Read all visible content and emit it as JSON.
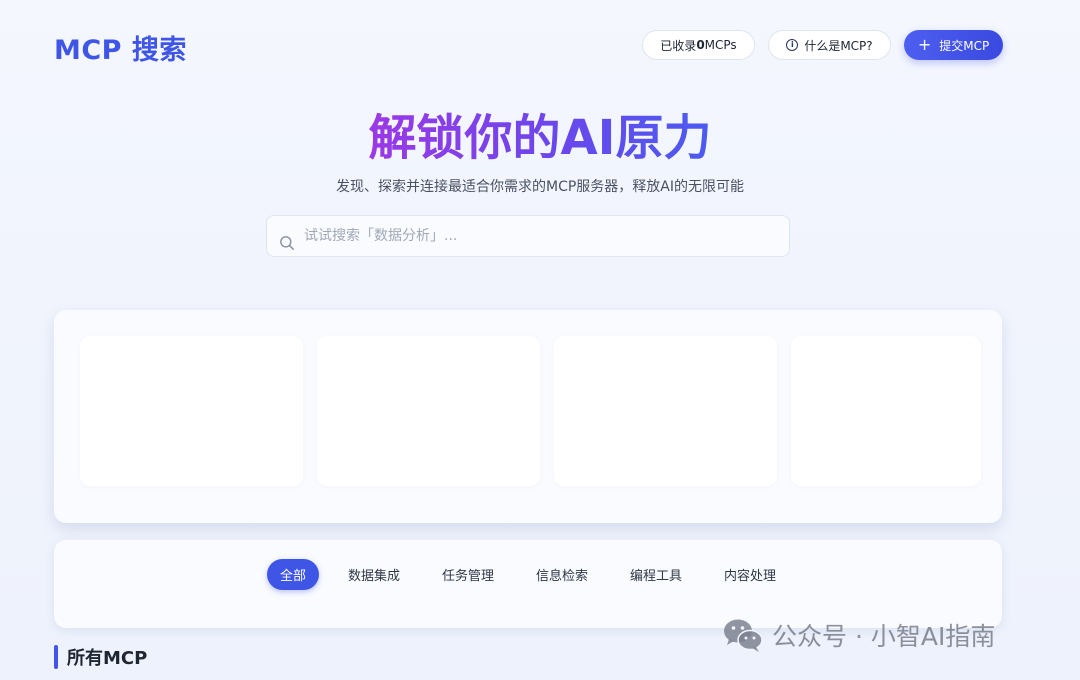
{
  "header": {
    "logo": "MCP 搜索",
    "count_prefix": "已收录",
    "count_value": "0",
    "count_suffix": "MCPs",
    "what_label": "什么是MCP?",
    "submit_label": "提交MCP",
    "info_icon": "info-icon",
    "plus_icon": "plus-icon"
  },
  "hero": {
    "title": "解锁你的AI原力",
    "subtitle": "发现、探索并连接最适合你需求的MCP服务器，释放AI的无限可能"
  },
  "search": {
    "placeholder": "试试搜索「数据分析」...",
    "icon": "search-icon"
  },
  "categories": {
    "items": [
      {
        "label": "全部",
        "active": true
      },
      {
        "label": "数据集成",
        "active": false
      },
      {
        "label": "任务管理",
        "active": false
      },
      {
        "label": "信息检索",
        "active": false
      },
      {
        "label": "编程工具",
        "active": false
      },
      {
        "label": "内容处理",
        "active": false
      }
    ]
  },
  "section": {
    "title": "所有MCP"
  },
  "watermark": {
    "text": "公众号 · 小智AI指南",
    "icon": "wechat-logo"
  },
  "colors": {
    "accent": "#3f55e6",
    "title_gradient_start": "#9b39e6",
    "title_gradient_end": "#4a5bf0",
    "background": "#f2f5fd"
  }
}
